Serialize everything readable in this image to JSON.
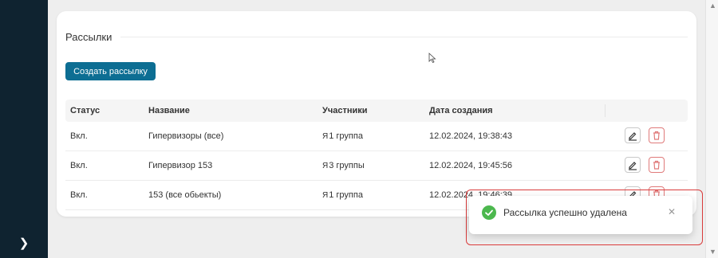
{
  "section": {
    "title": "Рассылки",
    "create_button": "Создать рассылку"
  },
  "table": {
    "headers": {
      "status": "Статус",
      "name": "Название",
      "participants": "Участники",
      "created": "Дата создания"
    },
    "rows": [
      {
        "status": "Вкл.",
        "name": "Гипервизоры (все)",
        "participants": "1 группа",
        "created": "12.02.2024, 19:38:43"
      },
      {
        "status": "Вкл.",
        "name": "Гипервизор 153",
        "participants": "3 группы",
        "created": "12.02.2024, 19:45:56"
      },
      {
        "status": "Вкл.",
        "name": "153 (все обьекты)",
        "participants": "1 группа",
        "created": "12.02.2024, 19:46:39"
      }
    ]
  },
  "toast": {
    "message": "Рассылка успешно удалена",
    "icon": "check-circle-icon",
    "close_icon": "close-icon"
  },
  "icons": {
    "edit": "pencil-icon",
    "delete": "trash-icon",
    "participants": "people-icon",
    "sidebar_expand": "chevron-right-icon"
  },
  "colors": {
    "primary": "#0d6e93",
    "danger": "#e07a7a",
    "success": "#4cb84e",
    "sidebar": "#0f2330"
  }
}
